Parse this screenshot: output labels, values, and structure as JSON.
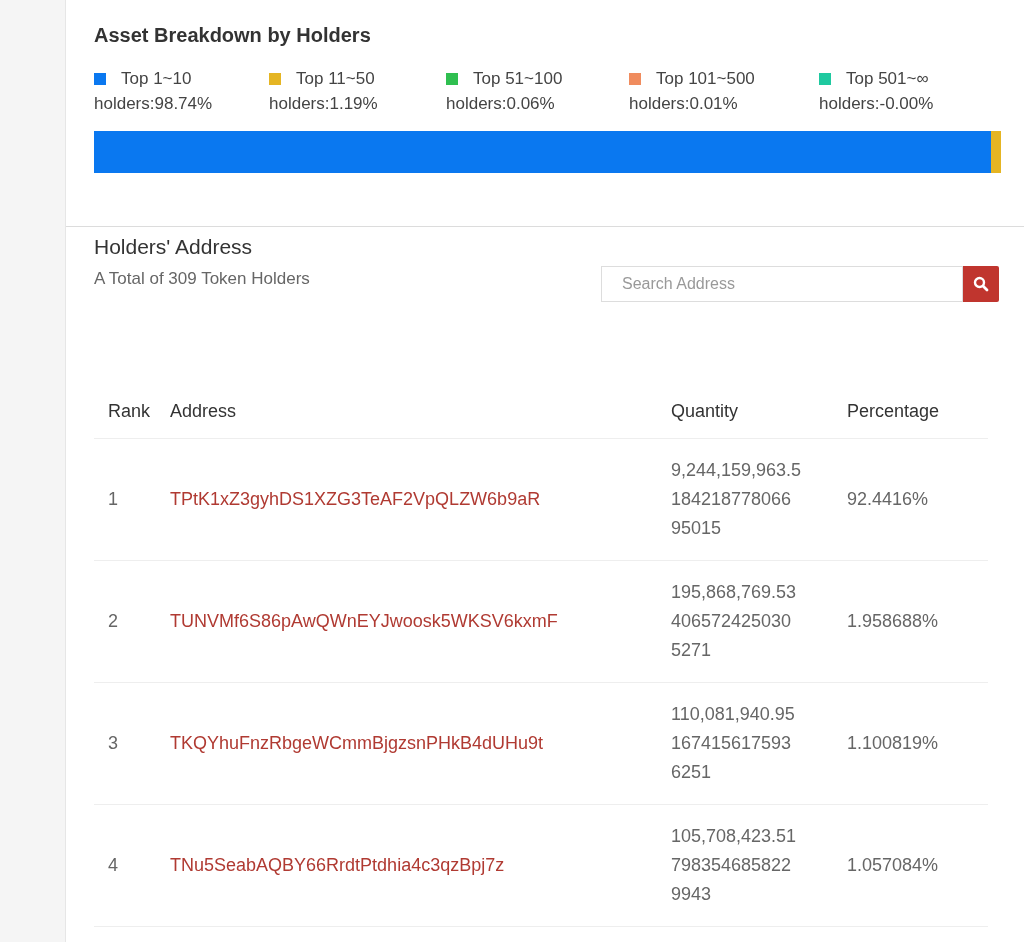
{
  "breakdown": {
    "title": "Asset Breakdown by Holders",
    "groups": [
      {
        "label": "Top 1~10",
        "value": "holders:98.74%",
        "color": "#0a78f0"
      },
      {
        "label": "Top 11~50",
        "value": "holders:1.19%",
        "color": "#e5b523"
      },
      {
        "label": "Top 51~100",
        "value": "holders:0.06%",
        "color": "#2fbf50"
      },
      {
        "label": "Top 101~500",
        "value": "holders:0.01%",
        "color": "#f08c5e"
      },
      {
        "label": "Top 501~∞",
        "value": "holders:-0.00%",
        "color": "#1fc9a0"
      }
    ]
  },
  "holders": {
    "title": "Holders' Address",
    "subtitle": "A Total of 309 Token Holders",
    "search": {
      "placeholder": "Search Address"
    },
    "columns": [
      "Rank",
      "Address",
      "Quantity",
      "Percentage"
    ],
    "rows": [
      {
        "rank": "1",
        "address": "TPtK1xZ3gyhDS1XZG3TeAF2VpQLZW6b9aR",
        "quantity_lines": [
          "9,244,159,963.5",
          "184218778066",
          "95015"
        ],
        "percentage": "92.4416%"
      },
      {
        "rank": "2",
        "address": "TUNVMf6S86pAwQWnEYJwoosk5WKSV6kxmF",
        "quantity_lines": [
          "195,868,769.53",
          "406572425030",
          "5271"
        ],
        "percentage": "1.958688%"
      },
      {
        "rank": "3",
        "address": "TKQYhuFnzRbgeWCmmBjgzsnPHkB4dUHu9t",
        "quantity_lines": [
          "110,081,940.95",
          "167415617593",
          "6251"
        ],
        "percentage": "1.100819%"
      },
      {
        "rank": "4",
        "address": "TNu5SeabAQBY66RrdtPtdhia4c3qzBpj7z",
        "quantity_lines": [
          "105,708,423.51",
          "798354685822",
          "9943"
        ],
        "percentage": "1.057084%"
      }
    ]
  }
}
